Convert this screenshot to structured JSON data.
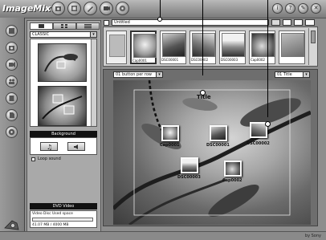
{
  "app": {
    "name": "ImageMixer",
    "vendor_mark": "by Sony"
  },
  "title_bar": {
    "left_buttons": [
      "import-icon",
      "album-icon",
      "edit-icon",
      "video-icon",
      "disc-icon"
    ],
    "right_buttons": [
      "info-icon",
      "settings-icon",
      "tools-icon",
      "close-icon"
    ]
  },
  "left_toolbar": {
    "buttons": [
      "album-icon",
      "camera-icon",
      "video-capture-icon",
      "people-icon",
      "book-icon",
      "document-icon",
      "cd-burn-icon",
      "exit-icon"
    ]
  },
  "template_panel": {
    "tabs": [
      "layout-tab-icon",
      "grid-tab-icon",
      "list-tab-icon"
    ],
    "category_dropdown": "CLASSIC",
    "background_section_title": "Background",
    "loop_sound_label": "Loop sound",
    "dvd_section_title": "DVD Video",
    "disc_space_label": "Video Disc",
    "used_space_label": "Used space",
    "space_value": "41.07 MB / 4000 MB"
  },
  "project": {
    "title_field": "Untitled",
    "filmstrip_items": [
      {
        "caption": "Cap0001"
      },
      {
        "caption": "DSC00001"
      },
      {
        "caption": "DSC00002"
      },
      {
        "caption": "DSC00003"
      },
      {
        "caption": "Cap0002"
      },
      {
        "caption": ""
      }
    ]
  },
  "preview": {
    "button_dropdown": "01 button per row",
    "title_dropdown": "01 Title",
    "menu_title": "Title",
    "menu_items": [
      {
        "label": "Cap0001"
      },
      {
        "label": "DSC00001"
      },
      {
        "label": "DSC00002"
      },
      {
        "label": "DSC00003"
      },
      {
        "label": "Cap0002"
      }
    ]
  }
}
